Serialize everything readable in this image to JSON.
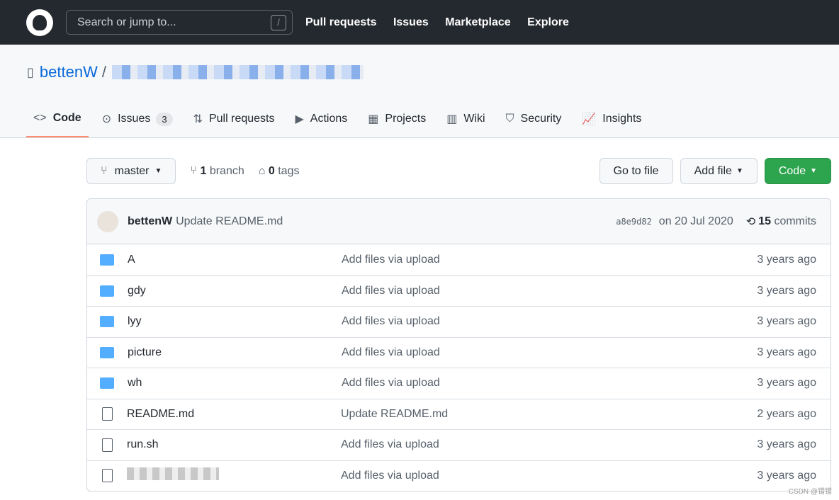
{
  "header": {
    "search_placeholder": "Search or jump to...",
    "search_shortcut": "/",
    "nav": [
      "Pull requests",
      "Issues",
      "Marketplace",
      "Explore"
    ]
  },
  "repo": {
    "owner": "bettenW",
    "separator": "/"
  },
  "tabs": [
    {
      "label": "Code",
      "icon": "code-icon"
    },
    {
      "label": "Issues",
      "count": "3",
      "icon": "issue-icon"
    },
    {
      "label": "Pull requests",
      "icon": "pull-request-icon"
    },
    {
      "label": "Actions",
      "icon": "play-icon"
    },
    {
      "label": "Projects",
      "icon": "table-icon"
    },
    {
      "label": "Wiki",
      "icon": "book-icon"
    },
    {
      "label": "Security",
      "icon": "shield-icon"
    },
    {
      "label": "Insights",
      "icon": "graph-icon"
    }
  ],
  "toolbar": {
    "branch": "master",
    "branch_count": "1",
    "branch_label": "branch",
    "tag_count": "0",
    "tag_label": "tags",
    "go_to_file": "Go to file",
    "add_file": "Add file",
    "code": "Code"
  },
  "commit": {
    "author": "bettenW",
    "message": "Update README.md",
    "sha": "a8e9d82",
    "date": "on 20 Jul 2020",
    "count": "15",
    "count_label": "commits"
  },
  "files": [
    {
      "type": "folder",
      "name": "A",
      "message": "Add files via upload",
      "age": "3 years ago"
    },
    {
      "type": "folder",
      "name": "gdy",
      "message": "Add files via upload",
      "age": "3 years ago"
    },
    {
      "type": "folder",
      "name": "lyy",
      "message": "Add files via upload",
      "age": "3 years ago"
    },
    {
      "type": "folder",
      "name": "picture",
      "message": "Add files via upload",
      "age": "3 years ago"
    },
    {
      "type": "folder",
      "name": "wh",
      "message": "Add files via upload",
      "age": "3 years ago"
    },
    {
      "type": "file",
      "name": "README.md",
      "message": "Update README.md",
      "age": "2 years ago"
    },
    {
      "type": "file",
      "name": "run.sh",
      "message": "Add files via upload",
      "age": "3 years ago"
    },
    {
      "type": "file",
      "name": "",
      "message": "Add files via upload",
      "age": "3 years ago"
    }
  ],
  "watermark": "CSDN @错错"
}
